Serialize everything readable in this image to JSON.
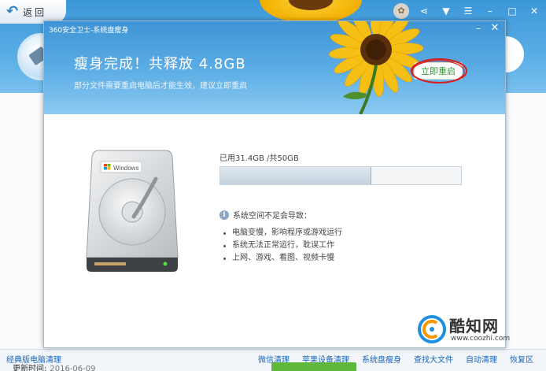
{
  "background": {
    "back_label": "返回",
    "footer_left": "经典版电脑清理",
    "footer_links": [
      "微信清理",
      "苹果设备清理",
      "系统盘瘦身",
      "查找大文件",
      "自动清理",
      "恢复区"
    ],
    "update_label": "更新时间:",
    "update_date": "2016-06-09"
  },
  "dialog": {
    "title": "360安全卫士-系统盘瘦身",
    "headline": "瘦身完成！共释放 4.8GB",
    "subtitle": "部分文件需要重启电脑后才能生效，建议立即重启",
    "restart_button": "立即重启",
    "disk_brand": "Windows",
    "usage_text": "已用31.4GB /共50GB",
    "usage_fraction": 0.628,
    "info_title": "系统空间不足会导致：",
    "bullets": [
      "电脑变慢，影响程序或游戏运行",
      "系统无法正常运行，耽误工作",
      "上网、游戏、看图、视频卡慢"
    ]
  },
  "watermark": {
    "title": "酷知网",
    "url": "www.coozhi.com"
  },
  "colors": {
    "header_blue": "#3e95d6",
    "restart_green": "#2e9a2e",
    "annotation_red": "#d81e1e"
  }
}
